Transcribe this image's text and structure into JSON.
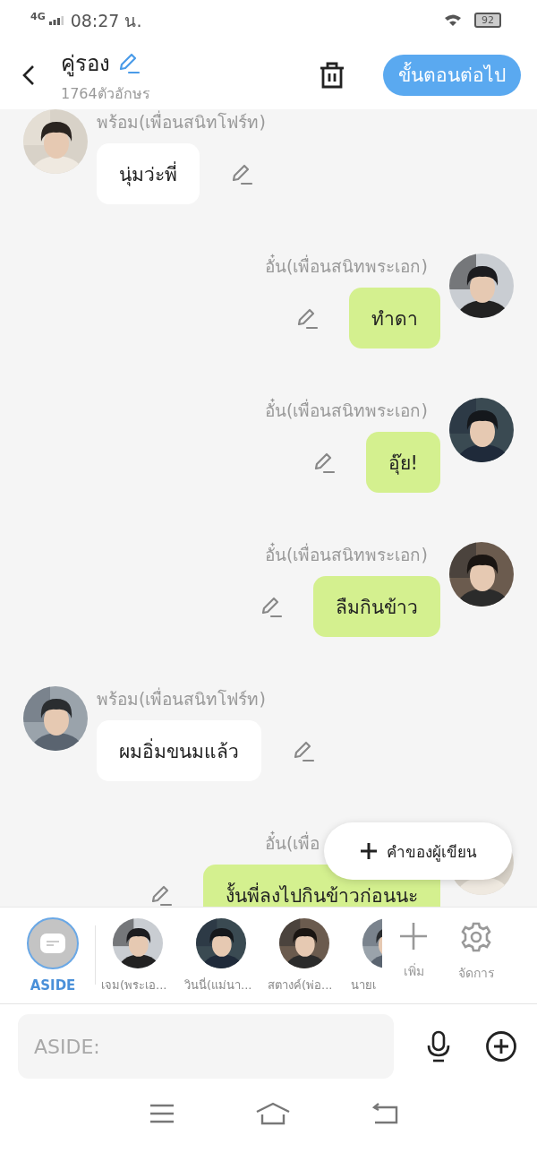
{
  "status_bar": {
    "network": "4G",
    "time": "08:27 น.",
    "battery": "92"
  },
  "header": {
    "title": "คู่รอง",
    "subtitle": "1764ตัวอักษร",
    "next_button": "ขั้นตอนต่อไป"
  },
  "messages": [
    {
      "kind": "received",
      "name": "พร้อม(เพื่อนสนิทโฟร์ท)",
      "text": "นุ่มว่ะพี่"
    },
    {
      "kind": "sent",
      "name": "อั๋น(เพื่อนสนิทพระเอก)",
      "text": "ทำดา"
    },
    {
      "kind": "sent",
      "name": "อั๋น(เพื่อนสนิทพระเอก)",
      "text": "อุ๊ย!"
    },
    {
      "kind": "sent",
      "name": "อั๋น(เพื่อนสนิทพระเอก)",
      "text": "ลืมกินข้าว"
    },
    {
      "kind": "received",
      "name": "พร้อม(เพื่อนสนิทโฟร์ท)",
      "text": "ผมอิ่มขนมแล้ว"
    },
    {
      "kind": "sent",
      "name": "อั๋น(เพื่อ",
      "text": "งั้นพี่ลงไปกินข้าวก่อนนะ"
    }
  ],
  "floating_button": "คำของผู้เขียน",
  "characters": [
    {
      "kind": "aside",
      "name": "ASIDE",
      "selected": true
    },
    {
      "kind": "character",
      "name": "เจม(พระเอ...",
      "selected": false
    },
    {
      "kind": "character",
      "name": "วินนี่(แม่นา...",
      "selected": false
    },
    {
      "kind": "character",
      "name": "สตางค์(พ่อ...",
      "selected": false
    },
    {
      "kind": "character",
      "name": "นายเ",
      "selected": false
    }
  ],
  "tools": [
    {
      "kind": "add",
      "label": "เพิ่ม"
    },
    {
      "kind": "manage",
      "label": "จัดการ"
    }
  ],
  "input": {
    "placeholder": "ASIDE:"
  }
}
